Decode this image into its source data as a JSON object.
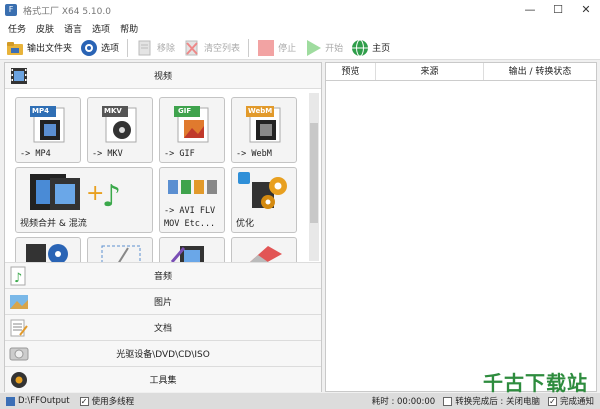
{
  "window": {
    "title": "格式工厂 X64 5.10.0",
    "min": "—",
    "max": "☐",
    "close": "✕"
  },
  "menu": {
    "items": [
      "任务",
      "皮肤",
      "语言",
      "选项",
      "帮助"
    ]
  },
  "toolbar": {
    "output_folder": "输出文件夹",
    "options": "选项",
    "remove": "移除",
    "clear_list": "清空列表",
    "stop": "停止",
    "start": "开始",
    "home": "主页"
  },
  "categories": {
    "video": "视频",
    "audio": "音频",
    "image": "图片",
    "document": "文档",
    "optical": "光驱设备\\DVD\\CD\\ISO",
    "tools": "工具集"
  },
  "video_tiles": {
    "mp4": {
      "badge": "MP4",
      "label": "-> MP4"
    },
    "mkv": {
      "badge": "MKV",
      "label": "-> MKV"
    },
    "gif": {
      "badge": "GIF",
      "label": "-> GIF"
    },
    "webm": {
      "badge": "WebM",
      "label": "-> WebM"
    },
    "merge": {
      "label": "视频合并 & 混流"
    },
    "avi": {
      "label_line1": "-> AVI FLV",
      "label_line2": "MOV Etc..."
    },
    "optimize": {
      "label": "优化"
    }
  },
  "task_table": {
    "col_preview": "预览",
    "col_source": "来源",
    "col_output": "输出 / 转换状态"
  },
  "statusbar": {
    "output_path": "D:\\FFOutput",
    "multithread": "使用多线程",
    "elapsed": "耗时 : 00:00:00",
    "after_convert": "转换完成后 : 关闭电脑",
    "notify": "完成通知"
  },
  "watermark": "千古下载站",
  "colors": {
    "accent": "#2e8c3e",
    "mp4_badge": "#2f6fb5",
    "mkv_badge": "#555555",
    "gif_badge": "#3fa34d",
    "webm_badge": "#e29a2b"
  }
}
